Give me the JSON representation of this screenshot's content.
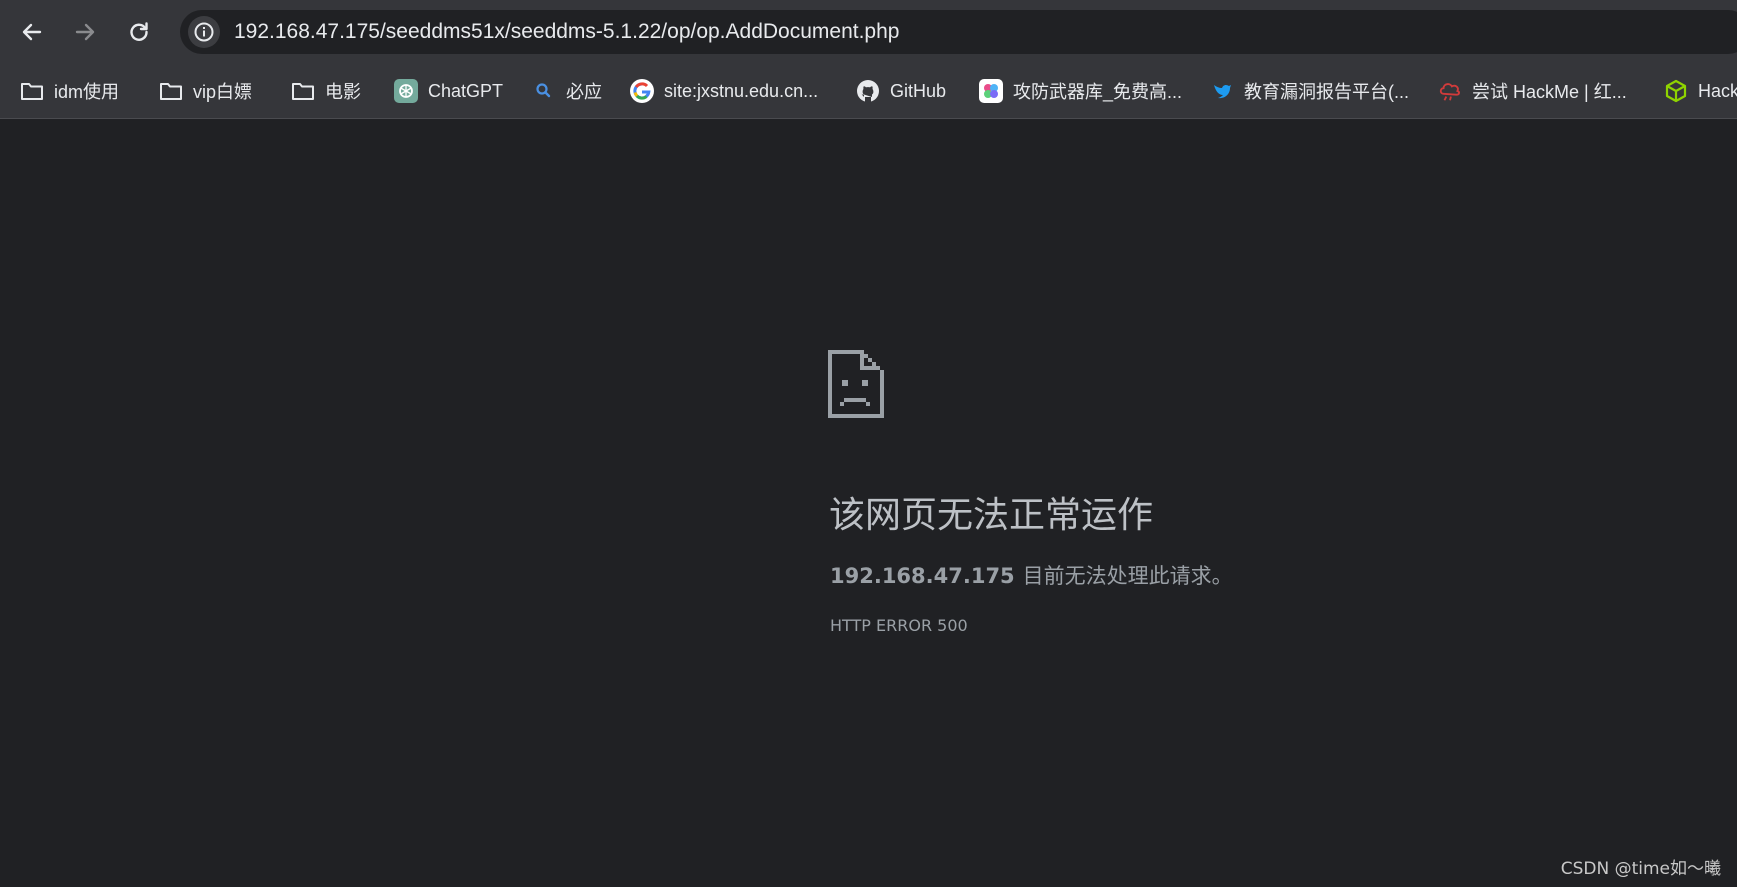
{
  "toolbar": {
    "back_icon": "arrow-left-icon",
    "forward_icon": "arrow-right-icon",
    "reload_icon": "reload-icon",
    "site_info_icon": "info-icon",
    "url": "192.168.47.175/seeddms51x/seeddms-5.1.22/op/op.AddDocument.php"
  },
  "bookmarks": [
    {
      "label": "idm使用",
      "icon": "folder-icon"
    },
    {
      "label": "vip白嫖",
      "icon": "folder-icon"
    },
    {
      "label": "电影",
      "icon": "folder-icon"
    },
    {
      "label": "ChatGPT",
      "icon": "chatgpt-icon"
    },
    {
      "label": "必应",
      "icon": "search-icon"
    },
    {
      "label": "site:jxstnu.edu.cn...",
      "icon": "google-icon"
    },
    {
      "label": "GitHub",
      "icon": "github-icon"
    },
    {
      "label": "攻防武器库_免费高...",
      "icon": "weapon-library-icon"
    },
    {
      "label": "教育漏洞报告平台(...",
      "icon": "bird-icon"
    },
    {
      "label": "尝试 HackMe | 红...",
      "icon": "cloud-alert-icon"
    },
    {
      "label": "Hack",
      "icon": "cube-icon"
    }
  ],
  "error": {
    "icon": "sad-page-icon",
    "title": "该网页无法正常运作",
    "host": "192.168.47.175",
    "description": "目前无法处理此请求。",
    "code": "HTTP ERROR 500"
  },
  "watermark": "CSDN @time如～曦",
  "colors": {
    "background": "#202124",
    "toolbar": "#35363a",
    "text_primary": "#e8eaed",
    "text_secondary": "#9aa0a6"
  }
}
